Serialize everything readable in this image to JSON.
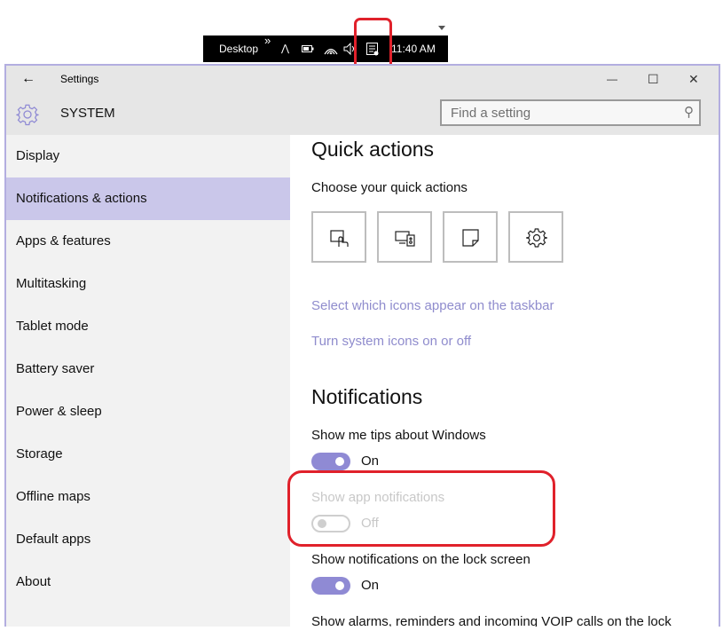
{
  "taskbar": {
    "desktop_label": "Desktop",
    "overflow_glyph": "»",
    "caret_glyph": "⋀",
    "time": "11:40 AM",
    "icons": [
      "battery-icon",
      "wifi-icon",
      "volume-icon",
      "action-center-icon"
    ]
  },
  "window": {
    "title": "Settings",
    "back_glyph": "←",
    "minimize_glyph": "—",
    "maximize_glyph": "☐",
    "close_glyph": "✕"
  },
  "header": {
    "section_title": "SYSTEM",
    "search_placeholder": "Find a setting",
    "search_glyph": "⚲"
  },
  "sidebar": {
    "items": [
      {
        "label": "Display",
        "selected": false
      },
      {
        "label": "Notifications & actions",
        "selected": true
      },
      {
        "label": "Apps & features",
        "selected": false
      },
      {
        "label": "Multitasking",
        "selected": false
      },
      {
        "label": "Tablet mode",
        "selected": false
      },
      {
        "label": "Battery saver",
        "selected": false
      },
      {
        "label": "Power & sleep",
        "selected": false
      },
      {
        "label": "Storage",
        "selected": false
      },
      {
        "label": "Offline maps",
        "selected": false
      },
      {
        "label": "Default apps",
        "selected": false
      },
      {
        "label": "About",
        "selected": false
      }
    ]
  },
  "content": {
    "quick_actions_heading": "Quick actions",
    "choose_label": "Choose your quick actions",
    "quick_action_tiles": [
      "tablet-mode-icon",
      "connect-icon",
      "note-icon",
      "all-settings-icon"
    ],
    "link_taskbar_icons": "Select which icons appear on the taskbar",
    "link_system_icons": "Turn system icons on or off",
    "notifications_heading": "Notifications",
    "settings": [
      {
        "label": "Show me tips about Windows",
        "state": "On",
        "enabled": true
      },
      {
        "label": "Show app notifications",
        "state": "Off",
        "enabled": false
      },
      {
        "label": "Show notifications on the lock screen",
        "state": "On",
        "enabled": true
      }
    ],
    "truncated_label": "Show alarms, reminders and incoming VOIP calls on the lock"
  },
  "colors": {
    "accent": "#8f8ad4",
    "selected_nav": "#cac7ea",
    "link": "#8f8ccd",
    "highlight_box": "#e0212b"
  }
}
